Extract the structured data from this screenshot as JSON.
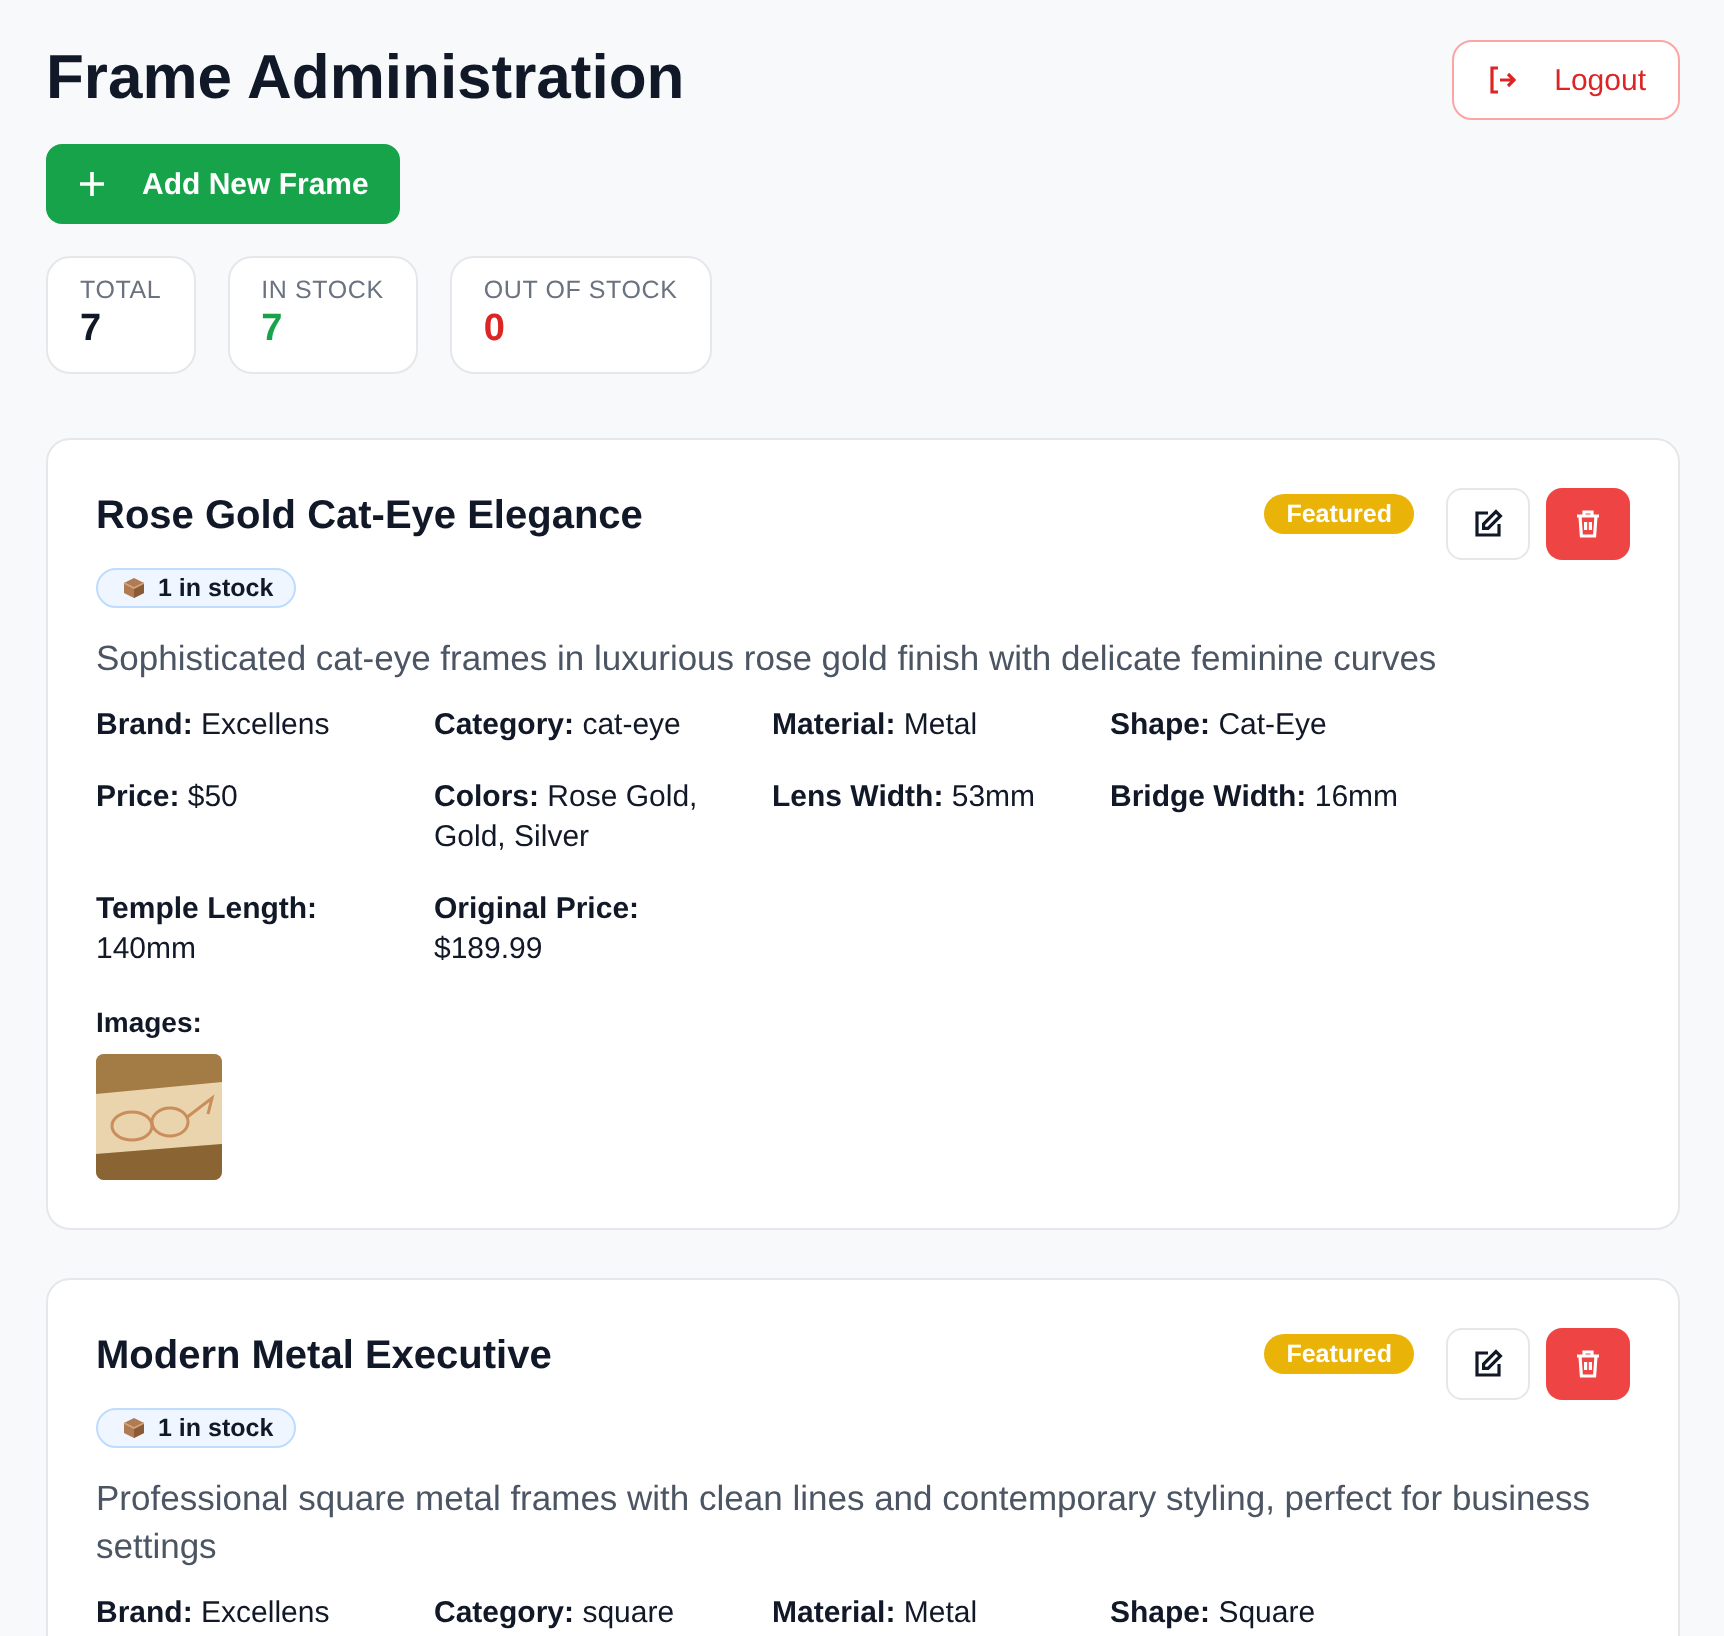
{
  "title": "Frame Administration",
  "add_button": "Add New Frame",
  "logout_button": "Logout",
  "stats": [
    {
      "label": "TOTAL",
      "value": "7",
      "color": "#111827"
    },
    {
      "label": "IN STOCK",
      "value": "7",
      "color": "#16a34a"
    },
    {
      "label": "OUT OF STOCK",
      "value": "0",
      "color": "#dc2626"
    }
  ],
  "frames": [
    {
      "name": "Rose Gold Cat-Eye Elegance",
      "stock": "1 in stock",
      "badge": "Featured",
      "description": "Sophisticated cat-eye frames in luxurious rose gold finish with delicate feminine curves",
      "details": [
        {
          "label": "Brand:",
          "value": "Excellens"
        },
        {
          "label": "Category:",
          "value": "cat-eye"
        },
        {
          "label": "Material:",
          "value": "Metal"
        },
        {
          "label": "Shape:",
          "value": "Cat-Eye"
        },
        {
          "label": "Price:",
          "value": "$50"
        },
        {
          "label": "Colors:",
          "value": "Rose Gold, Gold, Silver"
        },
        {
          "label": "Lens Width:",
          "value": "53mm"
        },
        {
          "label": "Bridge Width:",
          "value": "16mm"
        },
        {
          "label": "Temple Length:",
          "value": "140mm"
        },
        {
          "label": "Original Price:",
          "value": "$189.99"
        }
      ],
      "images_label": "Images:"
    },
    {
      "name": "Modern Metal Executive",
      "stock": "1 in stock",
      "badge": "Featured",
      "description": "Professional square metal frames with clean lines and contemporary styling, perfect for business settings",
      "details": [
        {
          "label": "Brand:",
          "value": "Excellens"
        },
        {
          "label": "Category:",
          "value": "square"
        },
        {
          "label": "Material:",
          "value": "Metal"
        },
        {
          "label": "Shape:",
          "value": "Square"
        }
      ]
    }
  ]
}
